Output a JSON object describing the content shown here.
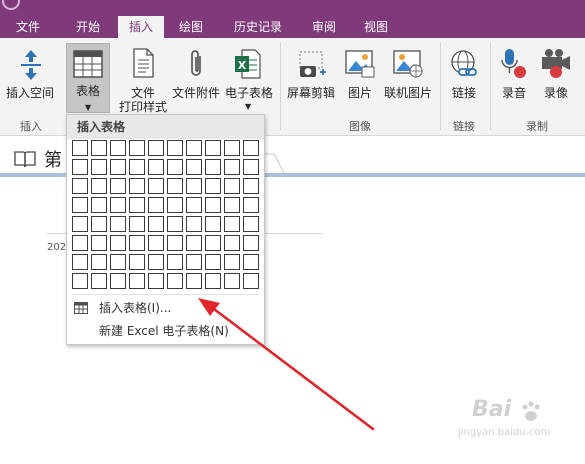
{
  "tabs": [
    {
      "label": "文件"
    },
    {
      "label": "开始"
    },
    {
      "label": "插入"
    },
    {
      "label": "绘图"
    },
    {
      "label": "历史记录"
    },
    {
      "label": "审阅"
    },
    {
      "label": "视图"
    }
  ],
  "ribbon": {
    "insert_space": "插入空间",
    "table": "表格",
    "file_printout_line1": "文件",
    "file_printout_line2": "打印样式",
    "file_attachment": "文件附件",
    "spreadsheet": "电子表格",
    "screen_clipping": "屏幕剪辑",
    "picture": "图片",
    "online_picture": "联机图片",
    "link": "链接",
    "record_audio": "录音",
    "record_video": "录像",
    "groups": {
      "insert": "插入",
      "images": "图像",
      "links": "链接",
      "recording": "录制"
    }
  },
  "page": {
    "tab_title": "第",
    "date_fragment": "202"
  },
  "dropdown": {
    "header": "插入表格",
    "item_insert_table": "插入表格(I)...",
    "item_new_excel": "新建 Excel 电子表格(N)"
  },
  "watermark": {
    "brand": "Bai",
    "sub": "jingyan.baidu.com"
  },
  "colors": {
    "tabbar": "#80397b",
    "ribbon": "#f3f3f3",
    "annotation_arrow": "#e0262b",
    "page_rule": "#a8c2db"
  }
}
